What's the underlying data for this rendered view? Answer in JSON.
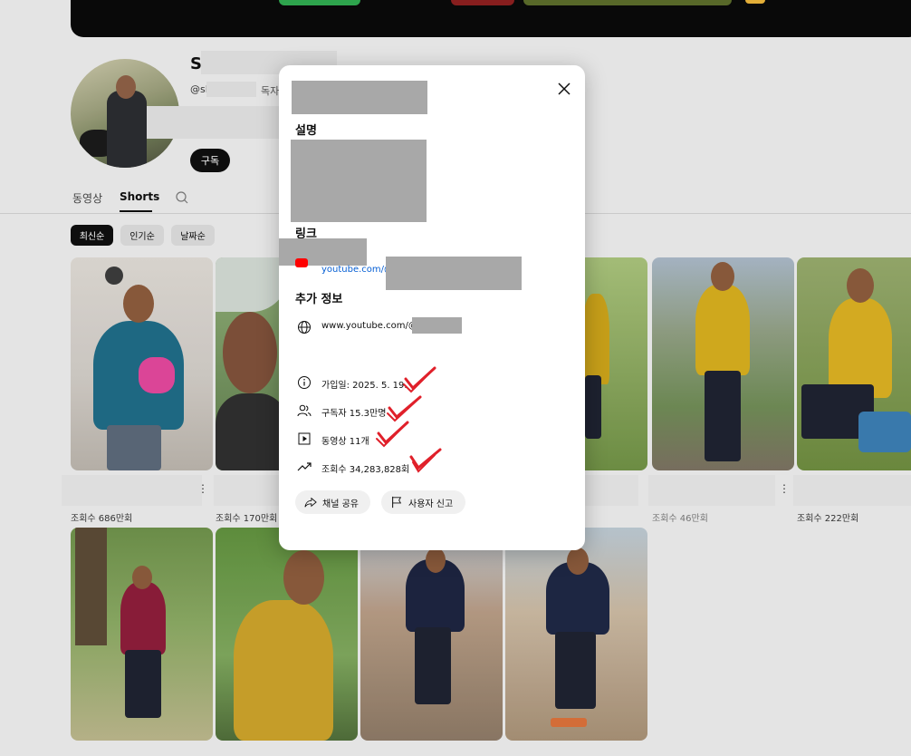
{
  "channel": {
    "name_partial": "S",
    "handle": "@sl",
    "subscriber_fragment": "독자",
    "subscribe_label": "구독"
  },
  "tabs": [
    {
      "label": "동영상"
    },
    {
      "label": "Shorts"
    }
  ],
  "chips": [
    {
      "label": "최신순"
    },
    {
      "label": "인기순"
    },
    {
      "label": "날짜순"
    }
  ],
  "shorts": [
    {
      "views": "조회수 686만회"
    },
    {
      "views": "조회수 170만회"
    },
    {
      "views": ""
    },
    {
      "views": ""
    },
    {
      "views": "조회수 46만회"
    },
    {
      "views": "조회수 222만회"
    },
    {
      "views": ""
    },
    {
      "views": ""
    },
    {
      "views": ""
    },
    {
      "views": ""
    }
  ],
  "modal": {
    "description_heading": "설명",
    "links_heading": "링크",
    "link_url": "youtube.com/@",
    "more_info_heading": "추가 정보",
    "website": "www.youtube.com/@",
    "joined": "가입일: 2025. 5. 19.",
    "subscribers": "구독자 15.3만명",
    "videos": "동영상 11개",
    "views": "조회수 34,283,828회",
    "share_label": "채널 공유",
    "report_label": "사용자 신고"
  },
  "colors": {
    "accent": "#0f0f0f",
    "link": "#065fd4",
    "annotation": "#e0202a"
  }
}
